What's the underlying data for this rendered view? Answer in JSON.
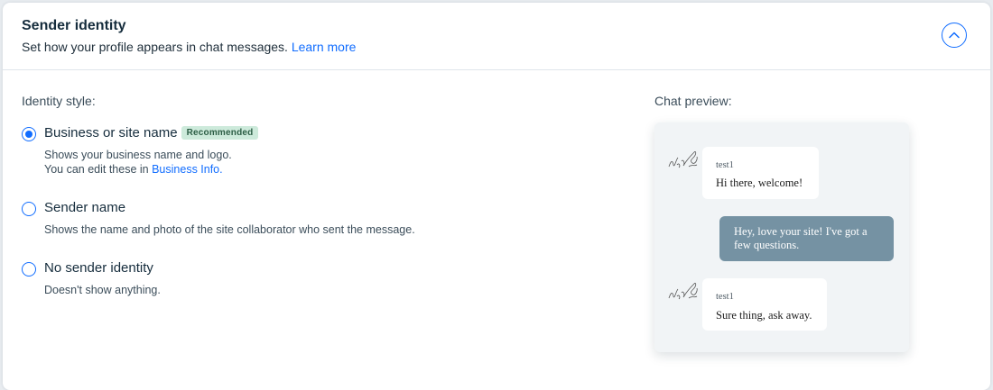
{
  "header": {
    "title": "Sender identity",
    "subtitle": "Set how your profile appears in chat messages.",
    "learn_more": "Learn more",
    "collapse_icon": "chevron-up-icon"
  },
  "identity": {
    "label": "Identity style:",
    "options": [
      {
        "title": "Business or site name",
        "badge": "Recommended",
        "desc_line1": "Shows your business name and logo.",
        "desc_line2_prefix": "You can edit these in",
        "desc_link": "Business Info.",
        "selected": true
      },
      {
        "title": "Sender name",
        "desc_line1": "Shows the name and photo of the site collaborator who sent the message.",
        "selected": false
      },
      {
        "title": "No sender identity",
        "desc_line1": "Doesn't show anything.",
        "selected": false
      }
    ]
  },
  "preview": {
    "label": "Chat preview:",
    "messages": [
      {
        "sender": "test1",
        "text": "Hi there, welcome!"
      },
      {
        "text": "Hey, love your site! I've got a few questions."
      },
      {
        "sender": "test1",
        "text": "Sure thing, ask away."
      }
    ]
  },
  "colors": {
    "accent": "#116dff",
    "badge_bg": "#cdeadb",
    "outgoing_bubble": "#7592a3",
    "preview_bg": "#f1f4f6"
  }
}
